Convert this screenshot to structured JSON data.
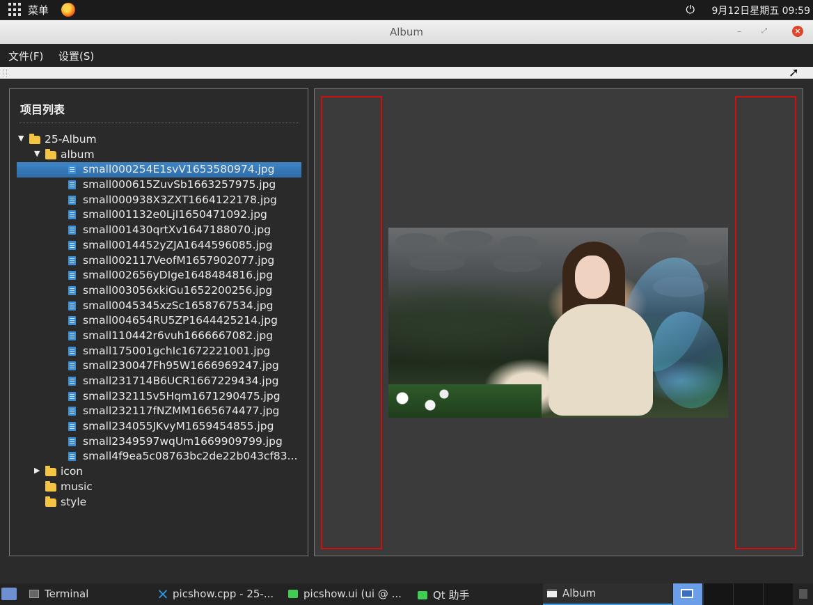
{
  "topbar": {
    "menu_label": "菜单",
    "clock": "9月12日星期五 09:59"
  },
  "window": {
    "title": "Album"
  },
  "menubar": {
    "file": "文件(F)",
    "settings": "设置(S)"
  },
  "left_panel": {
    "title": "项目列表",
    "tree": [
      {
        "label": "25-Album",
        "kind": "folder",
        "level": 0,
        "expanded": true
      },
      {
        "label": "album",
        "kind": "folder",
        "level": 1,
        "expanded": true
      },
      {
        "label": "small000254E1svV1653580974.jpg",
        "kind": "file",
        "level": 3,
        "selected": true
      },
      {
        "label": "small000615ZuvSb1663257975.jpg",
        "kind": "file",
        "level": 3
      },
      {
        "label": "small000938X3ZXT1664122178.jpg",
        "kind": "file",
        "level": 3
      },
      {
        "label": "small001132e0LjI1650471092.jpg",
        "kind": "file",
        "level": 3
      },
      {
        "label": "small001430qrtXv1647188070.jpg",
        "kind": "file",
        "level": 3
      },
      {
        "label": "small0014452yZJA1644596085.jpg",
        "kind": "file",
        "level": 3
      },
      {
        "label": "small002117VeofM1657902077.jpg",
        "kind": "file",
        "level": 3
      },
      {
        "label": "small002656yDIge1648484816.jpg",
        "kind": "file",
        "level": 3
      },
      {
        "label": "small003056xkiGu1652200256.jpg",
        "kind": "file",
        "level": 3
      },
      {
        "label": "small0045345xzSc1658767534.jpg",
        "kind": "file",
        "level": 3
      },
      {
        "label": "small004654RU5ZP1644425214.jpg",
        "kind": "file",
        "level": 3
      },
      {
        "label": "small110442r6vuh1666667082.jpg",
        "kind": "file",
        "level": 3
      },
      {
        "label": "small175001gchIc1672221001.jpg",
        "kind": "file",
        "level": 3
      },
      {
        "label": "small230047Fh95W1666969247.jpg",
        "kind": "file",
        "level": 3
      },
      {
        "label": "small231714B6UCR1667229434.jpg",
        "kind": "file",
        "level": 3
      },
      {
        "label": "small232115v5Hqm1671290475.jpg",
        "kind": "file",
        "level": 3
      },
      {
        "label": "small232117fNZMM1665674477.jpg",
        "kind": "file",
        "level": 3
      },
      {
        "label": "small234055JKvyM1659454855.jpg",
        "kind": "file",
        "level": 3
      },
      {
        "label": "small2349597wqUm1669909799.jpg",
        "kind": "file",
        "level": 3
      },
      {
        "label": "small4f9ea5c08763bc2de22b043cf83...",
        "kind": "file",
        "level": 3
      },
      {
        "label": "icon",
        "kind": "folder",
        "level": 1,
        "expanded": false,
        "has_children": true
      },
      {
        "label": "music",
        "kind": "folder",
        "level": 1
      },
      {
        "label": "style",
        "kind": "folder",
        "level": 1
      }
    ]
  },
  "taskbar": {
    "items": [
      {
        "label": "Terminal"
      },
      {
        "label": "picshow.cpp - 25-..."
      },
      {
        "label": "picshow.ui (ui @ ..."
      },
      {
        "label": "Qt 助手"
      },
      {
        "label": "Album"
      }
    ]
  },
  "colors": {
    "selection": "#3f85c5",
    "nav_border": "#d01010",
    "folder": "#f4c542",
    "file": "#3a8fd6"
  }
}
